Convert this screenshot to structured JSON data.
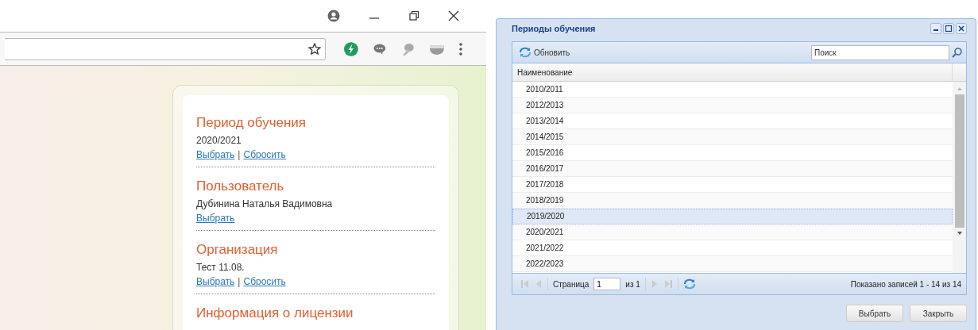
{
  "profile_sections": [
    {
      "title": "Период обучения",
      "value": "2020/2021",
      "links": [
        "Выбрать",
        "Сбросить"
      ],
      "separator": "|"
    },
    {
      "title": "Пользователь",
      "value": "Дубинина Наталья Вадимовна",
      "links": [
        "Выбрать"
      ]
    },
    {
      "title": "Организация",
      "value": "Тест 11.08.",
      "links": [
        "Выбрать",
        "Сбросить"
      ],
      "separator": "|"
    },
    {
      "title": "Информация о лицензии"
    }
  ],
  "dialog": {
    "title": "Периоды обучения",
    "toolbar": {
      "refresh_button": "Обновить",
      "search": {
        "placeholder": "Поиск"
      }
    },
    "grid": {
      "columns": [
        "Наименование"
      ],
      "rows": [
        {
          "name": "2010/2011",
          "selected": false
        },
        {
          "name": "2012/2013",
          "selected": false
        },
        {
          "name": "2013/2014",
          "selected": false
        },
        {
          "name": "2014/2015",
          "selected": false
        },
        {
          "name": "2015/2016",
          "selected": false
        },
        {
          "name": "2016/2017",
          "selected": false
        },
        {
          "name": "2017/2018",
          "selected": false
        },
        {
          "name": "2018/2019",
          "selected": false
        },
        {
          "name": "2019/2020",
          "selected": true
        },
        {
          "name": "2020/2021",
          "selected": false
        },
        {
          "name": "2021/2022",
          "selected": false
        },
        {
          "name": "2022/2023",
          "selected": false
        }
      ]
    },
    "paging": {
      "page_label": "Страница",
      "page_value": "1",
      "of_label": "из 1",
      "summary": "Показано записей 1 - 14 из 14"
    },
    "buttons": [
      "Выбрать",
      "Закрыть"
    ]
  }
}
